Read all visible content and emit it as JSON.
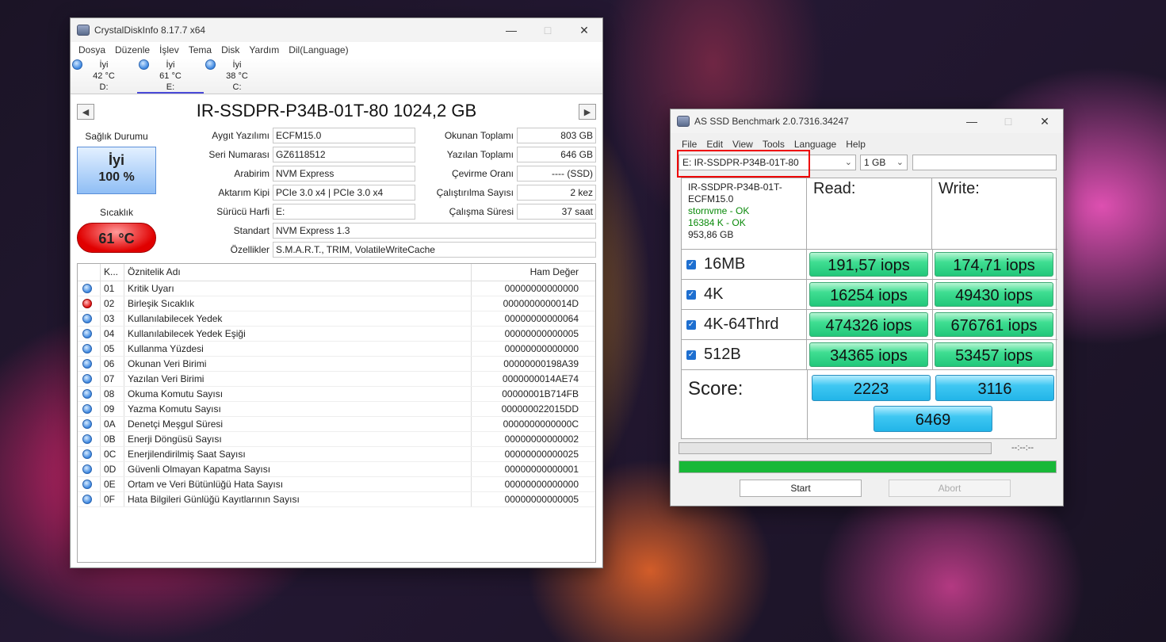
{
  "cdi": {
    "title": "CrystalDiskInfo 8.17.7 x64",
    "menu": [
      "Dosya",
      "Düzenle",
      "İşlev",
      "Tema",
      "Disk",
      "Yardım",
      "Dil(Language)"
    ],
    "drives": [
      {
        "status": "İyi",
        "temp": "42 °C",
        "letter": "D:"
      },
      {
        "status": "İyi",
        "temp": "61 °C",
        "letter": "E:"
      },
      {
        "status": "İyi",
        "temp": "38 °C",
        "letter": "C:"
      }
    ],
    "model": "IR-SSDPR-P34B-01T-80 1024,2 GB",
    "health_label": "Sağlık Durumu",
    "health_status": "İyi",
    "health_percent": "100 %",
    "temp_label": "Sıcaklık",
    "temp_value": "61 °C",
    "fields": {
      "firmware_label": "Aygıt Yazılımı",
      "firmware": "ECFM15.0",
      "serial_label": "Seri Numarası",
      "serial": "GZ6118512",
      "interface_label": "Arabirim",
      "interface": "NVM Express",
      "transfer_label": "Aktarım Kipi",
      "transfer": "PCIe 3.0 x4 | PCIe 3.0 x4",
      "letter_label": "Sürücü Harfi",
      "letter": "E:",
      "standard_label": "Standart",
      "standard": "NVM Express 1.3",
      "features_label": "Özellikler",
      "features": "S.M.A.R.T., TRIM, VolatileWriteCache",
      "reads_label": "Okunan Toplamı",
      "reads": "803 GB",
      "writes_label": "Yazılan Toplamı",
      "writes": "646 GB",
      "rotation_label": "Çevirme Oranı",
      "rotation": "---- (SSD)",
      "powercount_label": "Çalıştırılma Sayısı",
      "powercount": "2 kez",
      "powerhours_label": "Çalışma Süresi",
      "powerhours": "37 saat"
    },
    "table_headers": {
      "id": "K...",
      "name": "Öznitelik Adı",
      "raw": "Ham Değer"
    },
    "attributes": [
      {
        "id": "01",
        "name": "Kritik Uyarı",
        "raw": "00000000000000",
        "status": "blue"
      },
      {
        "id": "02",
        "name": "Birleşik Sıcaklık",
        "raw": "0000000000014D",
        "status": "red"
      },
      {
        "id": "03",
        "name": "Kullanılabilecek Yedek",
        "raw": "00000000000064",
        "status": "blue"
      },
      {
        "id": "04",
        "name": "Kullanılabilecek Yedek Eşiği",
        "raw": "00000000000005",
        "status": "blue"
      },
      {
        "id": "05",
        "name": "Kullanma Yüzdesi",
        "raw": "00000000000000",
        "status": "blue"
      },
      {
        "id": "06",
        "name": "Okunan Veri Birimi",
        "raw": "00000000198A39",
        "status": "blue"
      },
      {
        "id": "07",
        "name": "Yazılan Veri Birimi",
        "raw": "0000000014AE74",
        "status": "blue"
      },
      {
        "id": "08",
        "name": "Okuma Komutu Sayısı",
        "raw": "00000001B714FB",
        "status": "blue"
      },
      {
        "id": "09",
        "name": "Yazma Komutu Sayısı",
        "raw": "000000022015DD",
        "status": "blue"
      },
      {
        "id": "0A",
        "name": "Denetçi Meşgul Süresi",
        "raw": "0000000000000C",
        "status": "blue"
      },
      {
        "id": "0B",
        "name": "Enerji Döngüsü Sayısı",
        "raw": "00000000000002",
        "status": "blue"
      },
      {
        "id": "0C",
        "name": "Enerjilendirilmiş Saat Sayısı",
        "raw": "00000000000025",
        "status": "blue"
      },
      {
        "id": "0D",
        "name": "Güvenli Olmayan Kapatma Sayısı",
        "raw": "00000000000001",
        "status": "blue"
      },
      {
        "id": "0E",
        "name": "Ortam ve Veri Bütünlüğü Hata Sayısı",
        "raw": "00000000000000",
        "status": "blue"
      },
      {
        "id": "0F",
        "name": "Hata Bilgileri Günlüğü Kayıtlarının Sayısı",
        "raw": "00000000000005",
        "status": "blue"
      }
    ]
  },
  "asssd": {
    "title": "AS SSD Benchmark 2.0.7316.34247",
    "menu": [
      "File",
      "Edit",
      "View",
      "Tools",
      "Language",
      "Help"
    ],
    "drive_select": "E: IR-SSDPR-P34B-01T-80",
    "size_select": "1 GB",
    "info": {
      "model": "IR-SSDPR-P34B-01T-",
      "firmware": "ECFM15.0",
      "driver": "stornvme - OK",
      "align": "16384 K - OK",
      "size": "953,86 GB"
    },
    "read_label": "Read:",
    "write_label": "Write:",
    "tests": [
      {
        "name": "16MB",
        "read": "191,57 iops",
        "write": "174,71 iops"
      },
      {
        "name": "4K",
        "read": "16254 iops",
        "write": "49430 iops"
      },
      {
        "name": "4K-64Thrd",
        "read": "474326 iops",
        "write": "676761 iops"
      },
      {
        "name": "512B",
        "read": "34365 iops",
        "write": "53457 iops"
      }
    ],
    "score_label": "Score:",
    "score_read": "2223",
    "score_write": "3116",
    "score_total": "6469",
    "time": "--:--:--",
    "progress": 1.0,
    "start_label": "Start",
    "abort_label": "Abort",
    "colors": {
      "accent_green": "#22c77a",
      "accent_blue": "#22b5e8",
      "progress": "#18b838",
      "highlight": "#e00000"
    }
  }
}
